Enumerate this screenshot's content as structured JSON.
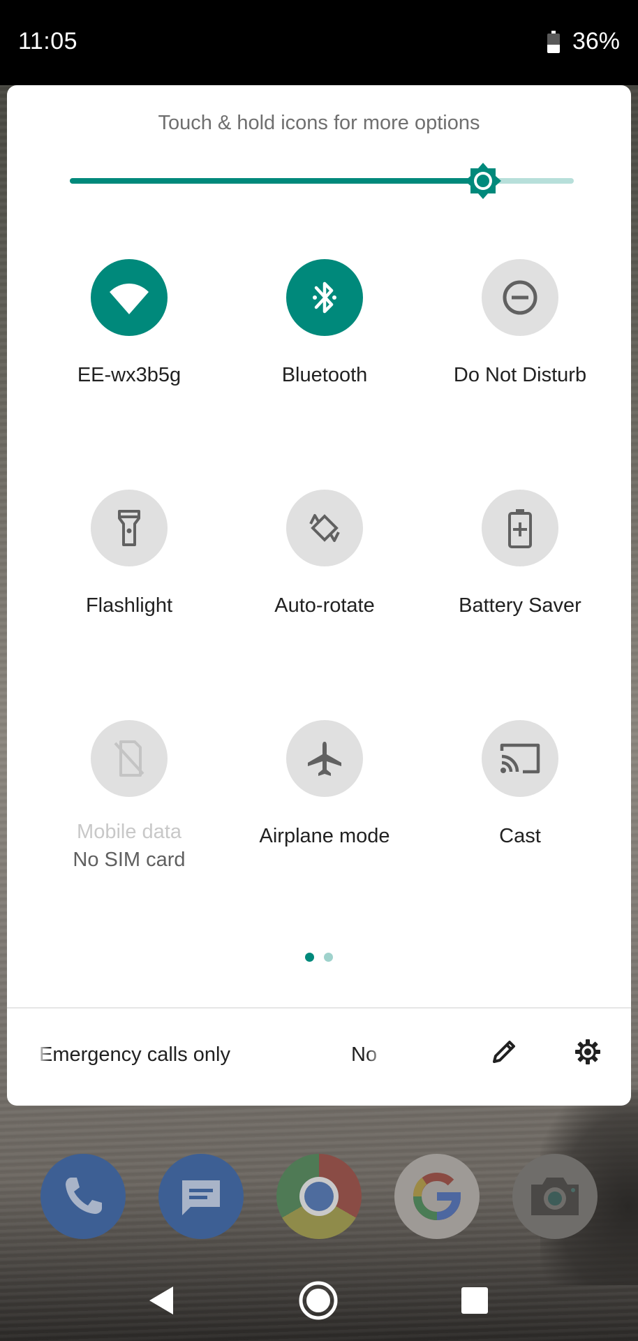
{
  "status_bar": {
    "time": "11:05",
    "battery_percent": "36%",
    "battery_level": 0.36
  },
  "quick_settings": {
    "hint": "Touch & hold icons for more options",
    "brightness_level": 0.82,
    "accent_color": "#00897b",
    "tiles": [
      {
        "label": "EE-wx3b5g",
        "icon": "wifi-icon",
        "active": true
      },
      {
        "label": "Bluetooth",
        "icon": "bluetooth-icon",
        "active": true
      },
      {
        "label": "Do Not Disturb",
        "icon": "do-not-disturb-icon",
        "active": false
      },
      {
        "label": "Flashlight",
        "icon": "flashlight-icon",
        "active": false
      },
      {
        "label": "Auto-rotate",
        "icon": "auto-rotate-icon",
        "active": false
      },
      {
        "label": "Battery Saver",
        "icon": "battery-saver-icon",
        "active": false
      },
      {
        "label": "Mobile data",
        "sublabel": "No SIM card",
        "icon": "mobile-data-icon",
        "active": false,
        "disabled": true
      },
      {
        "label": "Airplane mode",
        "icon": "airplane-icon",
        "active": false
      },
      {
        "label": "Cast",
        "icon": "cast-icon",
        "active": false
      }
    ],
    "page_count": 2,
    "current_page": 1,
    "footer": {
      "status": "Emergency calls only",
      "carrier_truncated": "No"
    }
  },
  "dock": {
    "apps": [
      "phone-icon",
      "messages-icon",
      "chrome-icon",
      "google-icon",
      "camera-icon"
    ]
  },
  "navigation": {
    "buttons": [
      "back-icon",
      "home-icon",
      "recents-icon"
    ]
  }
}
